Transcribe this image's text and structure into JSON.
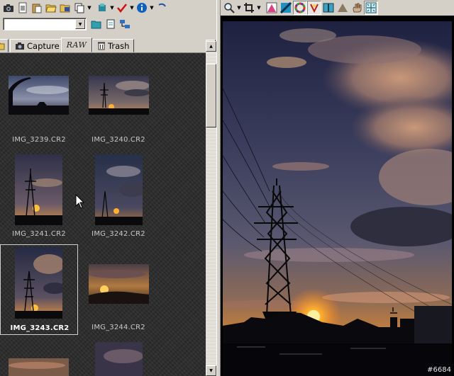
{
  "folder_combo": {
    "value": ""
  },
  "tabs": [
    {
      "id": "capture",
      "label": "Capture",
      "icon": "camera-icon"
    },
    {
      "id": "raw",
      "label": "RAW",
      "icon": "raw-icon"
    },
    {
      "id": "trash",
      "label": "Trash",
      "icon": "trash-icon"
    }
  ],
  "active_tab": "raw",
  "thumbnails": [
    {
      "filename": "IMG_3239.CR2",
      "orientation": "landscape",
      "selected": false
    },
    {
      "filename": "IMG_3240.CR2",
      "orientation": "landscape",
      "selected": false
    },
    {
      "filename": "IMG_3241.CR2",
      "orientation": "portrait",
      "selected": false
    },
    {
      "filename": "IMG_3242.CR2",
      "orientation": "portrait",
      "selected": false
    },
    {
      "filename": "IMG_3243.CR2",
      "orientation": "portrait",
      "selected": true
    },
    {
      "filename": "IMG_3244.CR2",
      "orientation": "landscape",
      "selected": false
    }
  ],
  "watermark": "#6684",
  "colors": {
    "window_face": "#d4d0c8",
    "thumb_bg": "#2a2a2a",
    "label_text": "#c8c8c8",
    "selected_label": "#ffffff",
    "sky_top": "#2b2f4c",
    "sun": "#ffb030"
  }
}
